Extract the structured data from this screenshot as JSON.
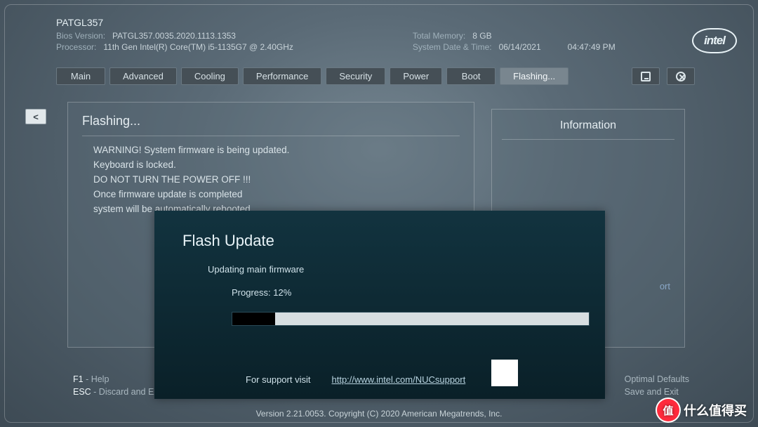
{
  "header": {
    "model": "PATGL357",
    "bios_version_label": "Bios Version:",
    "bios_version": "PATGL357.0035.2020.1113.1353",
    "processor_label": "Processor:",
    "processor": "11th Gen Intel(R) Core(TM) i5-1135G7 @ 2.40GHz",
    "total_memory_label": "Total Memory:",
    "total_memory": "8 GB",
    "datetime_label": "System Date & Time:",
    "date": "06/14/2021",
    "time": "04:47:49 PM",
    "logo_text": "intel"
  },
  "tabs": {
    "main": "Main",
    "advanced": "Advanced",
    "cooling": "Cooling",
    "performance": "Performance",
    "security": "Security",
    "power": "Power",
    "boot": "Boot",
    "flashing": "Flashing..."
  },
  "back_label": "<",
  "panel": {
    "title": "Flashing...",
    "line1": "WARNING! System firmware is being updated.",
    "line2": "Keyboard is locked.",
    "line3": "DO NOT TURN THE POWER OFF !!!",
    "line4": "Once firmware update is completed",
    "line5": "system will be automatically rebooted"
  },
  "info": {
    "title": "Information",
    "port_hint": "ort"
  },
  "dialog": {
    "title": "Flash Update",
    "status": "Updating main firmware",
    "progress_label": "Progress: 12%",
    "progress_pct": 12,
    "support_prefix": "For support visit",
    "support_url": "http://www.intel.com/NUCsupport"
  },
  "footer": {
    "f1_key": "F1",
    "f1_desc": " - Help",
    "esc_key": "ESC",
    "esc_desc": " - Discard and Exit",
    "f9_desc": "Optimal Defaults",
    "f10_desc": "Save and Exit"
  },
  "copyright": "Version 2.21.0053. Copyright (C) 2020 American Megatrends, Inc.",
  "watermark": {
    "badge": "值",
    "text": "什么值得买"
  }
}
